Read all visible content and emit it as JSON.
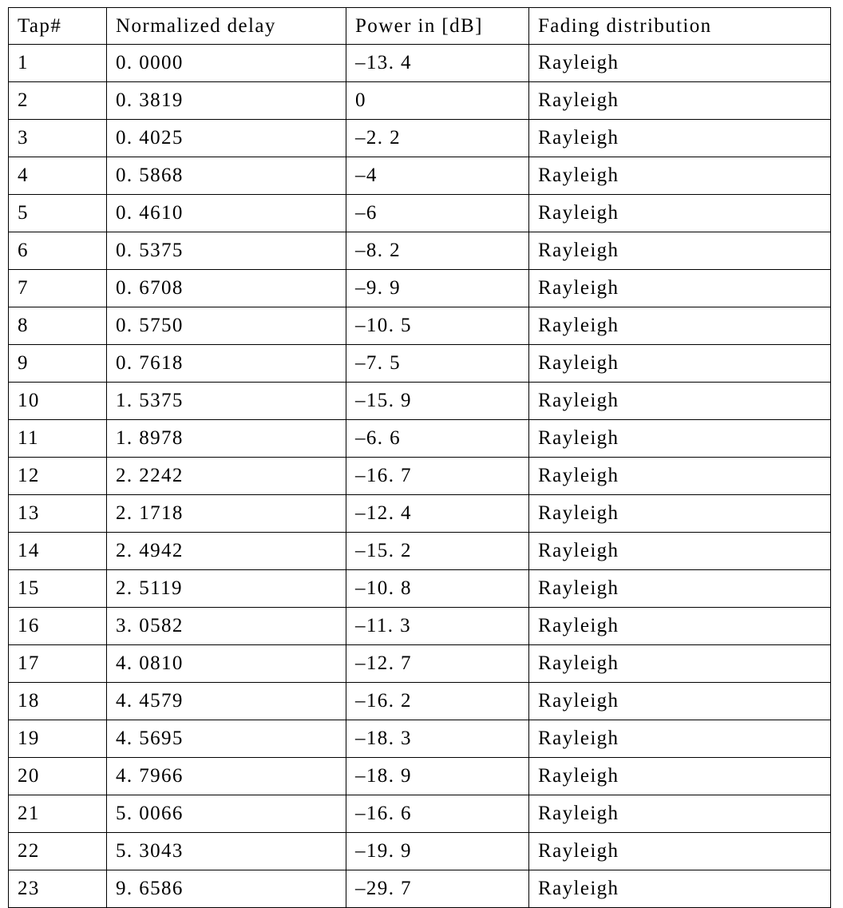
{
  "table": {
    "columns": [
      {
        "key": "tap",
        "label": "Tap#"
      },
      {
        "key": "delay",
        "label": "Normalized delay"
      },
      {
        "key": "power",
        "label": "Power in [dB]"
      },
      {
        "key": "fade",
        "label": "Fading distribution"
      }
    ],
    "rows": [
      {
        "tap": "1",
        "delay": "0. 0000",
        "power": "–13. 4",
        "fade": "Rayleigh"
      },
      {
        "tap": "2",
        "delay": "0. 3819",
        "power": "0",
        "fade": "Rayleigh"
      },
      {
        "tap": "3",
        "delay": "0. 4025",
        "power": "–2. 2",
        "fade": "Rayleigh"
      },
      {
        "tap": "4",
        "delay": "0. 5868",
        "power": "–4",
        "fade": "Rayleigh"
      },
      {
        "tap": "5",
        "delay": "0. 4610",
        "power": "–6",
        "fade": "Rayleigh"
      },
      {
        "tap": "6",
        "delay": "0. 5375",
        "power": "–8. 2",
        "fade": "Rayleigh"
      },
      {
        "tap": "7",
        "delay": "0. 6708",
        "power": "–9. 9",
        "fade": "Rayleigh"
      },
      {
        "tap": "8",
        "delay": "0. 5750",
        "power": "–10. 5",
        "fade": "Rayleigh"
      },
      {
        "tap": "9",
        "delay": "0. 7618",
        "power": "–7. 5",
        "fade": "Rayleigh"
      },
      {
        "tap": "10",
        "delay": "1. 5375",
        "power": "–15. 9",
        "fade": "Rayleigh"
      },
      {
        "tap": "11",
        "delay": "1. 8978",
        "power": "–6. 6",
        "fade": "Rayleigh"
      },
      {
        "tap": "12",
        "delay": "2. 2242",
        "power": "–16. 7",
        "fade": "Rayleigh"
      },
      {
        "tap": "13",
        "delay": "2. 1718",
        "power": "–12. 4",
        "fade": "Rayleigh"
      },
      {
        "tap": "14",
        "delay": "2. 4942",
        "power": "–15. 2",
        "fade": "Rayleigh"
      },
      {
        "tap": "15",
        "delay": "2. 5119",
        "power": "–10. 8",
        "fade": "Rayleigh"
      },
      {
        "tap": "16",
        "delay": "3. 0582",
        "power": "–11. 3",
        "fade": "Rayleigh"
      },
      {
        "tap": "17",
        "delay": "4. 0810",
        "power": "–12. 7",
        "fade": "Rayleigh"
      },
      {
        "tap": "18",
        "delay": "4. 4579",
        "power": "–16. 2",
        "fade": "Rayleigh"
      },
      {
        "tap": "19",
        "delay": "4. 5695",
        "power": "–18. 3",
        "fade": "Rayleigh"
      },
      {
        "tap": "20",
        "delay": "4. 7966",
        "power": "–18. 9",
        "fade": "Rayleigh"
      },
      {
        "tap": "21",
        "delay": "5. 0066",
        "power": "–16. 6",
        "fade": "Rayleigh"
      },
      {
        "tap": "22",
        "delay": "5. 3043",
        "power": "–19. 9",
        "fade": "Rayleigh"
      },
      {
        "tap": "23",
        "delay": "9. 6586",
        "power": "–29. 7",
        "fade": "Rayleigh"
      }
    ]
  }
}
